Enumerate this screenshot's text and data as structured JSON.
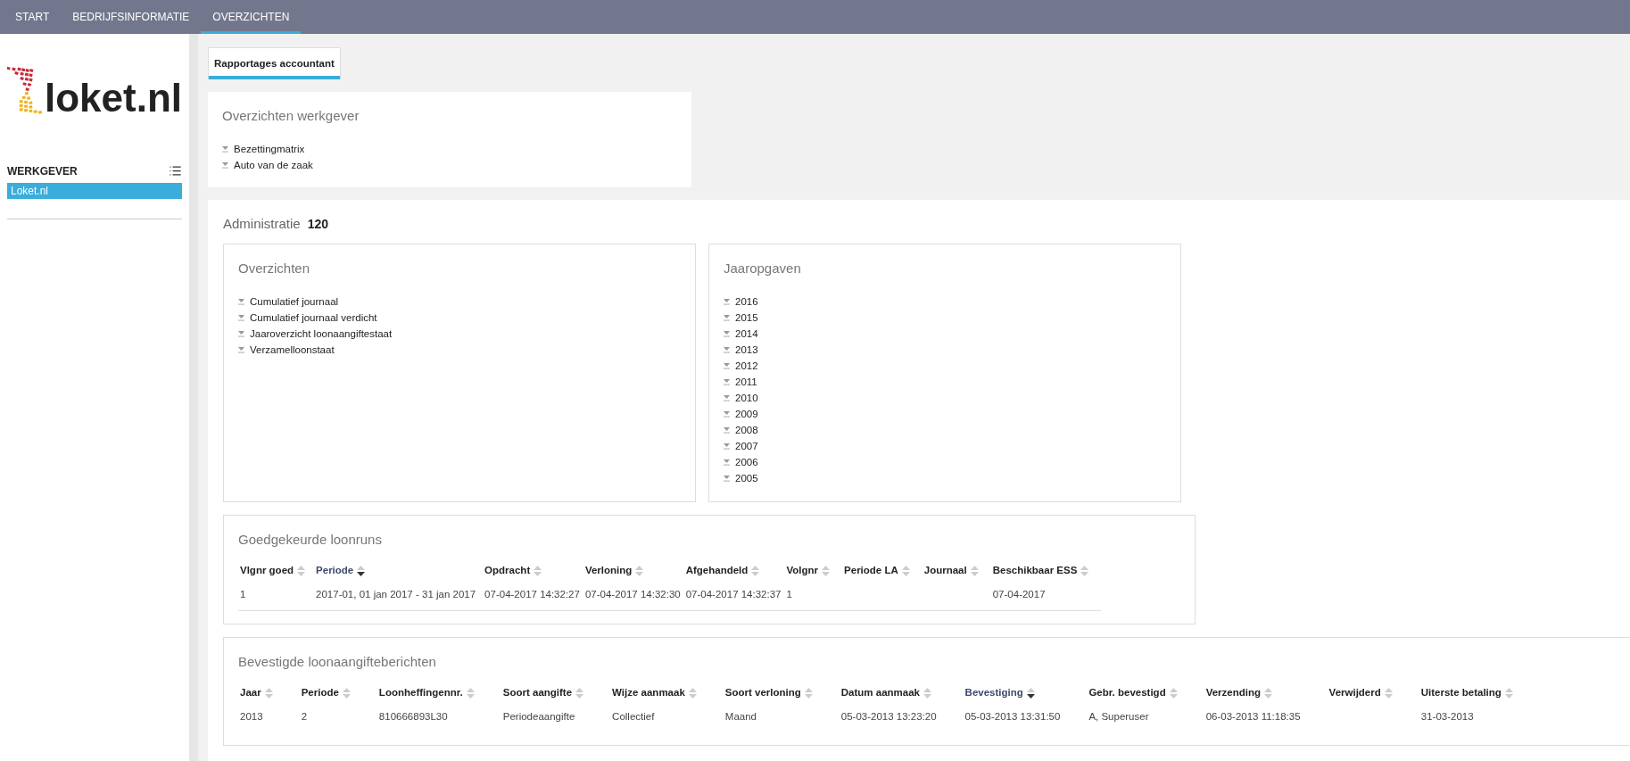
{
  "nav": [
    {
      "label": "START",
      "selected": false
    },
    {
      "label": "BEDRIJFSINFORMATIE",
      "selected": false
    },
    {
      "label": "OVERZICHTEN",
      "selected": true
    }
  ],
  "sidebar": {
    "logo_text": "loket.nl",
    "section_title": "WERKGEVER",
    "items": [
      {
        "label": "Loket.nl",
        "selected": true
      }
    ]
  },
  "page_tabs": [
    {
      "label": "Rapportages accountant",
      "selected": true
    }
  ],
  "employer_reports": {
    "title": "Overzichten werkgever",
    "items": [
      "Bezettingmatrix",
      "Auto van de zaak"
    ]
  },
  "administration": {
    "label": "Administratie",
    "number": "120",
    "overviews": {
      "title": "Overzichten",
      "items": [
        "Cumulatief journaal",
        "Cumulatief journaal verdicht",
        "Jaaroverzicht loonaangiftestaat",
        "Verzamelloonstaat"
      ]
    },
    "annual_statements": {
      "title": "Jaaropgaven",
      "items": [
        "2016",
        "2015",
        "2014",
        "2013",
        "2012",
        "2011",
        "2010",
        "2009",
        "2008",
        "2007",
        "2006",
        "2005"
      ]
    },
    "payroll_runs": {
      "title": "Goedgekeurde loonruns",
      "columns": [
        {
          "label": "Vlgnr goed",
          "sorted": false
        },
        {
          "label": "Periode",
          "sorted": true
        },
        {
          "label": "Opdracht",
          "sorted": false
        },
        {
          "label": "Verloning",
          "sorted": false
        },
        {
          "label": "Afgehandeld",
          "sorted": false
        },
        {
          "label": "Volgnr",
          "sorted": false
        },
        {
          "label": "Periode LA",
          "sorted": false
        },
        {
          "label": "Journaal",
          "sorted": false
        },
        {
          "label": "Beschikbaar ESS",
          "sorted": false
        }
      ],
      "rows": [
        [
          "1",
          "2017-01, 01 jan 2017 - 31 jan 2017",
          "07-04-2017 14:32:27",
          "07-04-2017 14:32:30",
          "07-04-2017 14:32:37",
          "1",
          "",
          "",
          "07-04-2017"
        ]
      ]
    },
    "tax_returns": {
      "title": "Bevestigde loonaangifteberichten",
      "columns": [
        {
          "label": "Jaar",
          "sorted": false
        },
        {
          "label": "Periode",
          "sorted": false
        },
        {
          "label": "Loonheffingennr.",
          "sorted": false
        },
        {
          "label": "Soort aangifte",
          "sorted": false
        },
        {
          "label": "Wijze aanmaak",
          "sorted": false
        },
        {
          "label": "Soort verloning",
          "sorted": false
        },
        {
          "label": "Datum aanmaak",
          "sorted": false
        },
        {
          "label": "Bevestiging",
          "sorted": true
        },
        {
          "label": "Gebr. bevestigd",
          "sorted": false
        },
        {
          "label": "Verzending",
          "sorted": false
        },
        {
          "label": "Verwijderd",
          "sorted": false
        },
        {
          "label": "Uiterste betaling",
          "sorted": false
        }
      ],
      "rows": [
        [
          "2013",
          "2",
          "810666893L30",
          "Periodeaangifte",
          "Collectief",
          "Maand",
          "05-03-2013 13:23:20",
          "05-03-2013 13:31:50",
          "A, Superuser",
          "06-03-2013 11:18:35",
          "",
          "31-03-2013"
        ]
      ]
    }
  }
}
